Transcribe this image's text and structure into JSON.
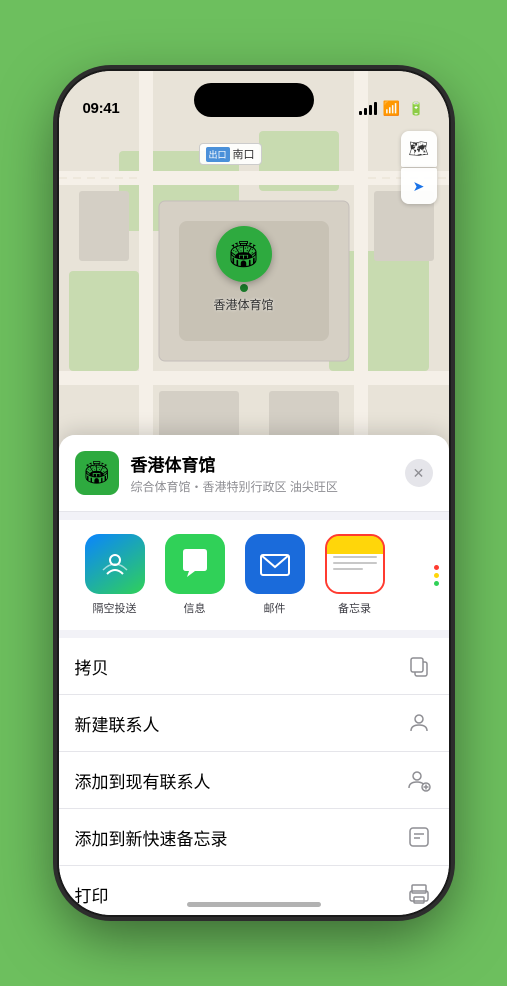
{
  "phone": {
    "time": "09:41",
    "map_label": "南口"
  },
  "location": {
    "name": "香港体育馆",
    "subtitle": "综合体育馆・香港特别行政区 油尖旺区",
    "pin_label": "香港体育馆"
  },
  "share": {
    "apps": [
      {
        "id": "airdrop",
        "label": "隔空投送"
      },
      {
        "id": "messages",
        "label": "信息"
      },
      {
        "id": "mail",
        "label": "邮件"
      },
      {
        "id": "notes",
        "label": "备忘录",
        "selected": true
      }
    ]
  },
  "actions": [
    {
      "id": "copy",
      "label": "拷贝",
      "icon": "📋"
    },
    {
      "id": "new-contact",
      "label": "新建联系人",
      "icon": "👤"
    },
    {
      "id": "add-existing",
      "label": "添加到现有联系人",
      "icon": "👤+"
    },
    {
      "id": "add-notes",
      "label": "添加到新快速备忘录",
      "icon": "📝"
    },
    {
      "id": "print",
      "label": "打印",
      "icon": "🖨"
    }
  ],
  "icons": {
    "map_layers": "🗺",
    "location_arrow": "➤",
    "close": "✕",
    "copy": "⊕",
    "contact": "⊕"
  }
}
